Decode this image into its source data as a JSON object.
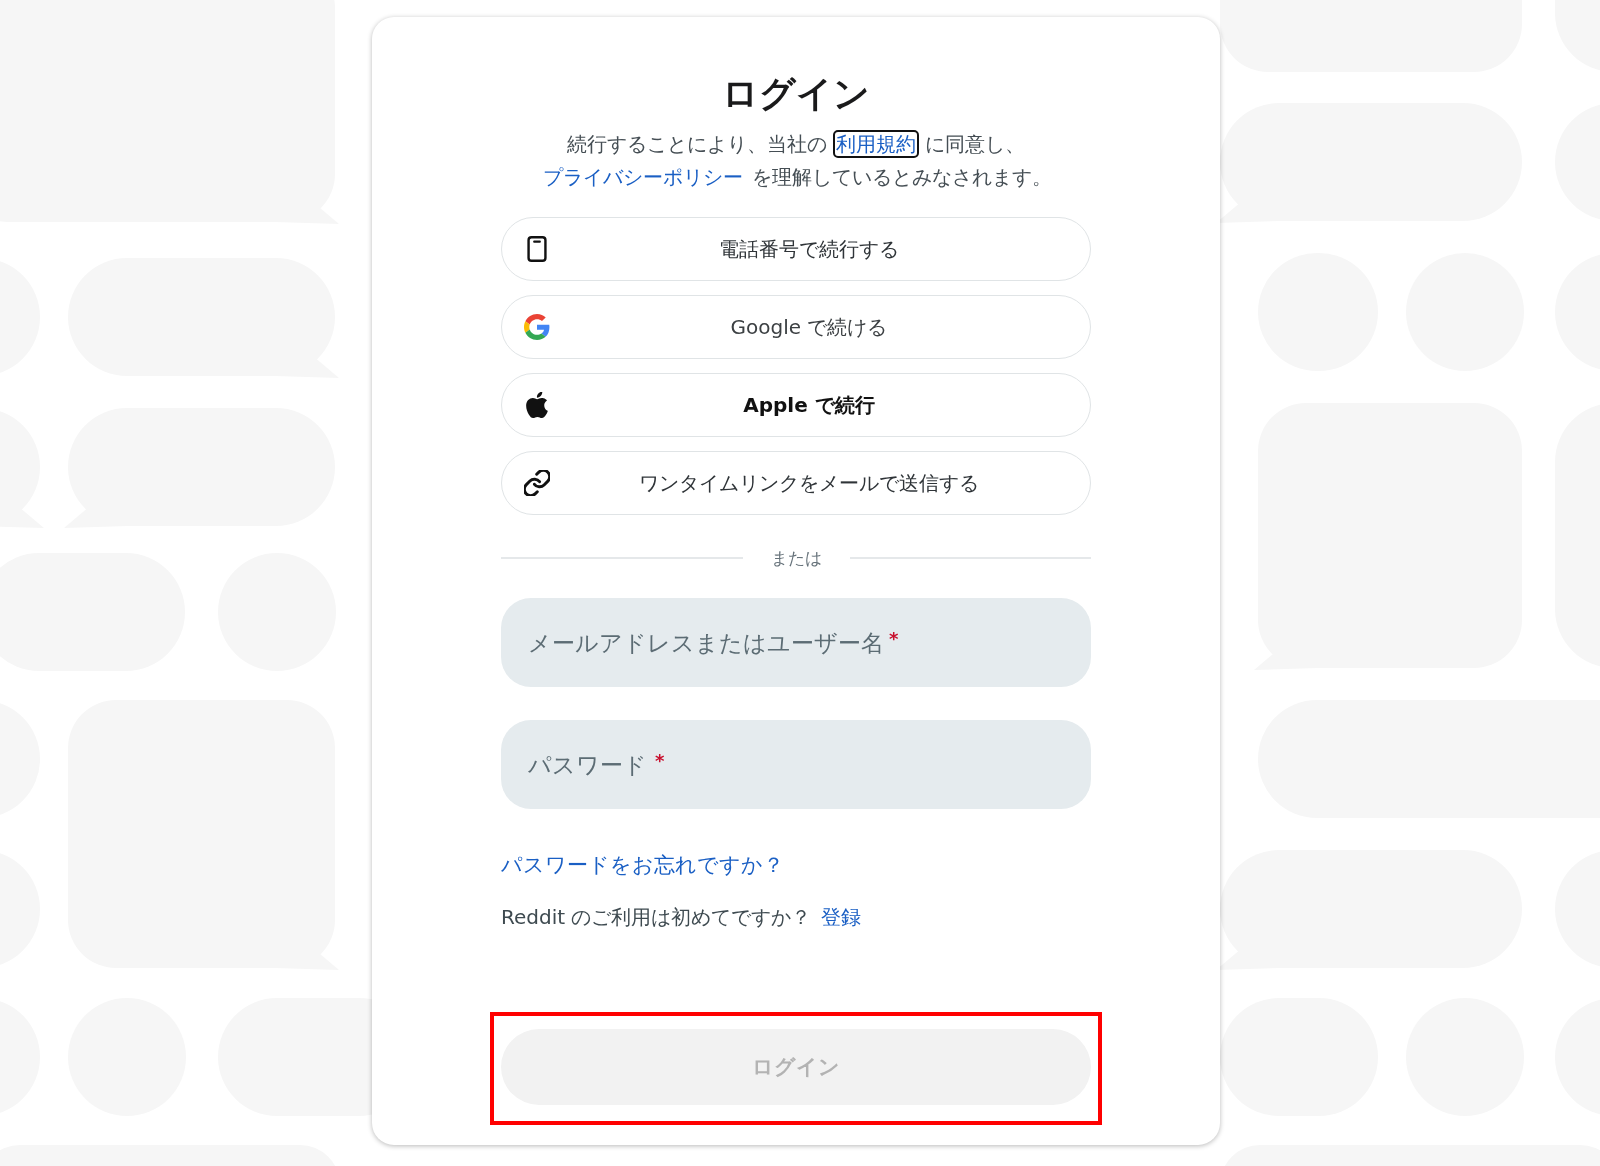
{
  "title": "ログイン",
  "consent": [
    {
      "kind": "text",
      "text": "続行することにより、当社の "
    },
    {
      "kind": "link",
      "text": "利用規約",
      "focused": true
    },
    {
      "kind": "text",
      "text": " に同意し、"
    },
    {
      "kind": "link",
      "text": "プライバシーポリシー",
      "focused": false
    },
    {
      "kind": "text",
      "text": " を理解しているとみなされます。"
    }
  ],
  "sign_in_options": [
    {
      "kind": "phone",
      "label": "電話番号で続行する"
    },
    {
      "kind": "google",
      "label": "Google で続ける"
    },
    {
      "kind": "apple",
      "label": "Apple で続行"
    },
    {
      "kind": "email_link",
      "label": "ワンタイムリンクをメールで送信する"
    }
  ],
  "divider": {
    "label": "または"
  },
  "fields": [
    {
      "placeholder": "メールアドレスまたはユーザー名",
      "required_mark": "*"
    },
    {
      "placeholder": "パスワード",
      "required_mark": "*"
    }
  ],
  "forgot_password_link": "パスワードをお忘れですか？",
  "signup_prompt": {
    "text": "Reddit のご利用は初めてですか？",
    "link": "登録"
  },
  "login_button": {
    "label": "ログイン",
    "disabled": true,
    "highlighted": true
  }
}
